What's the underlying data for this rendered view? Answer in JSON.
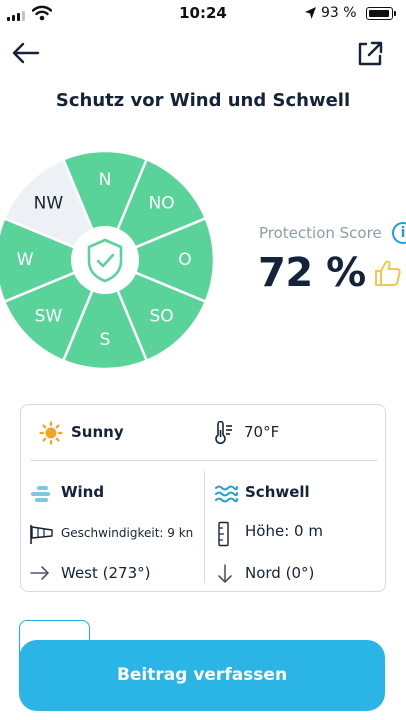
{
  "status_bar": {
    "time": "10:24",
    "battery_percent": "93 %"
  },
  "header": {
    "title": "Schutz vor Wind und Schwell"
  },
  "wind_rose": {
    "sectors": [
      {
        "label": "N",
        "protected": true
      },
      {
        "label": "NO",
        "protected": true
      },
      {
        "label": "O",
        "protected": true
      },
      {
        "label": "SO",
        "protected": true
      },
      {
        "label": "S",
        "protected": true
      },
      {
        "label": "SW",
        "protected": true
      },
      {
        "label": "W",
        "protected": true
      },
      {
        "label": "NW",
        "protected": false
      }
    ]
  },
  "score": {
    "label": "Protection Score",
    "value": "72 %",
    "info_icon": "i"
  },
  "weather": {
    "condition": "Sunny",
    "temperature": "70°F",
    "wind": {
      "title": "Wind",
      "speed": "Geschwindigkeit: 9 kn",
      "direction": "West (273°)"
    },
    "swell": {
      "title": "Schwell",
      "height": "Höhe: 0 m",
      "direction": "Nord (0°)"
    }
  },
  "cta": {
    "label": "Beitrag verfassen"
  },
  "colors": {
    "protected": "#5ad39a",
    "unprotected": "#edf1f6",
    "accent": "#2bb4e6",
    "sun": "#f2a42a",
    "text_dark": "#15233a"
  },
  "icons": [
    "back-arrow-icon",
    "share-icon",
    "shield-check-icon",
    "info-icon",
    "thumbs-up-icon",
    "sun-icon",
    "thermometer-icon",
    "wind-icon",
    "windsock-icon",
    "arrow-right-icon",
    "waves-icon",
    "ruler-icon",
    "arrow-down-icon"
  ]
}
